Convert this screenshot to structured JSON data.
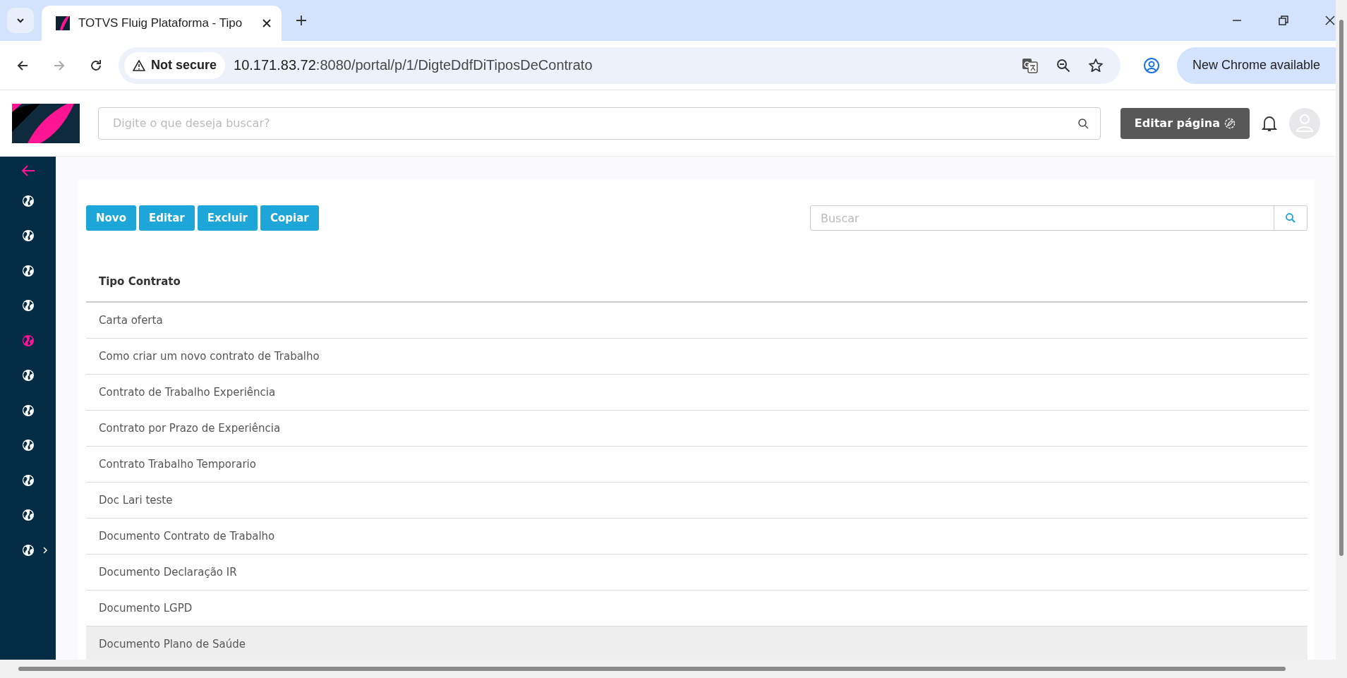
{
  "browser": {
    "tab_title": "TOTVS Fluig Plataforma - Tipo",
    "security": "Not secure",
    "url_host": "10.171.83.72",
    "url_path": ":8080/portal/p/1/DigteDdfDiTiposDeContrato",
    "update_button": "New Chrome available"
  },
  "header": {
    "search": {
      "placeholder": "Digite o que deseja buscar?"
    },
    "edit_button": "Editar página"
  },
  "sidebar": {
    "items": [
      {
        "selected": false,
        "has_submenu": false
      },
      {
        "selected": false,
        "has_submenu": false
      },
      {
        "selected": false,
        "has_submenu": false
      },
      {
        "selected": false,
        "has_submenu": false
      },
      {
        "selected": true,
        "has_submenu": false
      },
      {
        "selected": false,
        "has_submenu": false
      },
      {
        "selected": false,
        "has_submenu": false
      },
      {
        "selected": false,
        "has_submenu": false
      },
      {
        "selected": false,
        "has_submenu": false
      },
      {
        "selected": false,
        "has_submenu": false
      },
      {
        "selected": false,
        "has_submenu": true
      }
    ]
  },
  "toolbar": {
    "buttons": [
      "Novo",
      "Editar",
      "Excluir",
      "Copiar"
    ],
    "search": {
      "placeholder": "Buscar"
    }
  },
  "table": {
    "columns": [
      "Tipo Contrato"
    ],
    "rows": [
      {
        "cells": [
          "Carta oferta"
        ],
        "selected": false
      },
      {
        "cells": [
          "Como criar um novo contrato de Trabalho"
        ],
        "selected": false
      },
      {
        "cells": [
          "Contrato de Trabalho Experiência"
        ],
        "selected": false
      },
      {
        "cells": [
          "Contrato por Prazo de Experiência"
        ],
        "selected": false
      },
      {
        "cells": [
          "Contrato Trabalho Temporario"
        ],
        "selected": false
      },
      {
        "cells": [
          "Doc Lari teste"
        ],
        "selected": false
      },
      {
        "cells": [
          "Documento Contrato de Trabalho"
        ],
        "selected": false
      },
      {
        "cells": [
          "Documento Declaração IR"
        ],
        "selected": false
      },
      {
        "cells": [
          "Documento LGPD"
        ],
        "selected": false
      },
      {
        "cells": [
          "Documento Plano de Saúde"
        ],
        "selected": true
      }
    ]
  }
}
